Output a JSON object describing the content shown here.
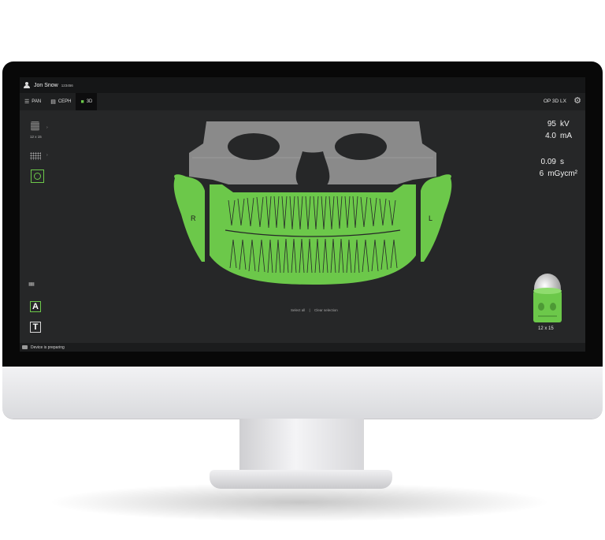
{
  "patient": {
    "name": "Jon Snow",
    "id": "123456"
  },
  "tabs": [
    {
      "label": "PAN",
      "icon": "menu-icon",
      "active": false
    },
    {
      "label": "CEPH",
      "icon": "ceph-icon",
      "active": false
    },
    {
      "label": "3D",
      "icon": "cube-icon",
      "active": true
    }
  ],
  "device": {
    "name": "OP 3D LX"
  },
  "toolbar": {
    "fov_label": "12 x 15",
    "tool_a": "A",
    "tool_t": "T"
  },
  "exposure": {
    "kv_value": "95",
    "kv_unit": "kV",
    "ma_value": "4.0",
    "ma_unit": "mA",
    "time_value": "0.09",
    "time_unit": "s",
    "dose_value": "6",
    "dose_unit": "mGycm²"
  },
  "skull": {
    "side_right": "R",
    "side_left": "L",
    "selected_color": "#6cc84a",
    "unselected_color": "#8a8a8a"
  },
  "selection": {
    "select_all": "Select all",
    "separator": "|",
    "clear": "Clear selection"
  },
  "fov_preview": {
    "label": "12 x 15"
  },
  "status": {
    "text": "Device is preparing"
  },
  "colors": {
    "accent": "#6cc84a",
    "background": "#262728"
  }
}
